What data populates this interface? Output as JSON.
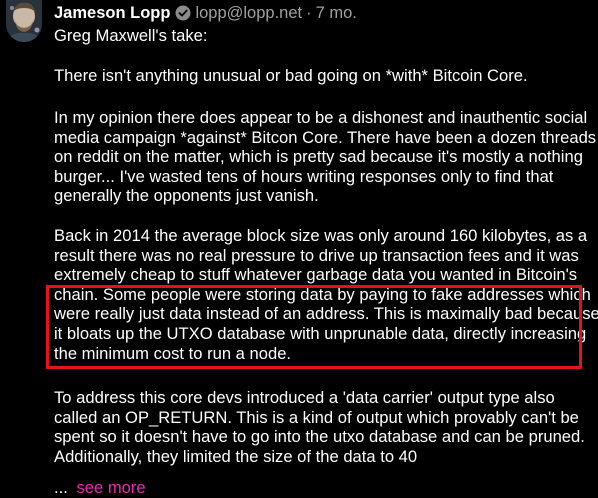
{
  "post": {
    "author": {
      "name": "Jameson Lopp",
      "handle": "lopp@lopp.net",
      "separator": "·",
      "time": "7 mo."
    },
    "paragraphs": {
      "p1": [
        "Greg Maxwell's take:"
      ],
      "p2": [
        "There isn't anything unusual or bad going on *with* Bitcoin Core."
      ],
      "p3": [
        "In my opinion there does appear to be a dishonest and inauthentic social",
        "media campaign *against* Bitcon Core. There have been a dozen threads",
        "on reddit on the matter, which is pretty sad because it's mostly a nothing",
        "burger... I've wasted tens of hours writing responses only to find that",
        "generally the opponents just vanish."
      ],
      "p4": [
        "Back in 2014 the average block size was only around 160 kilobytes, as a",
        "result there was no real pressure to drive up transaction fees and it was",
        "extremely cheap to stuff whatever garbage data you wanted in Bitcoin's",
        "chain. Some people were storing data by paying to fake addresses which",
        "were really just data instead of an address. This is maximally bad because",
        "it bloats up the UTXO database with unprunable data, directly increasing",
        "the minimum cost to run a node."
      ],
      "p5": [
        "To address this core devs introduced a 'data carrier' output type also",
        "called an OP_RETURN. This is a kind of output which provably can't be",
        "spent so it doesn't have to go into the utxo database and can be pruned.",
        "Additionally, they limited the size of the data to 40"
      ]
    },
    "ellipsis": "...",
    "see_more_label": "see more"
  },
  "colors": {
    "background": "#000000",
    "text": "#ffffff",
    "muted": "#a1a1a1",
    "link": "#e82ab0",
    "highlight_border": "#e4131b"
  },
  "icons": {
    "verified": "verified-badge-icon",
    "avatar": "avatar"
  }
}
